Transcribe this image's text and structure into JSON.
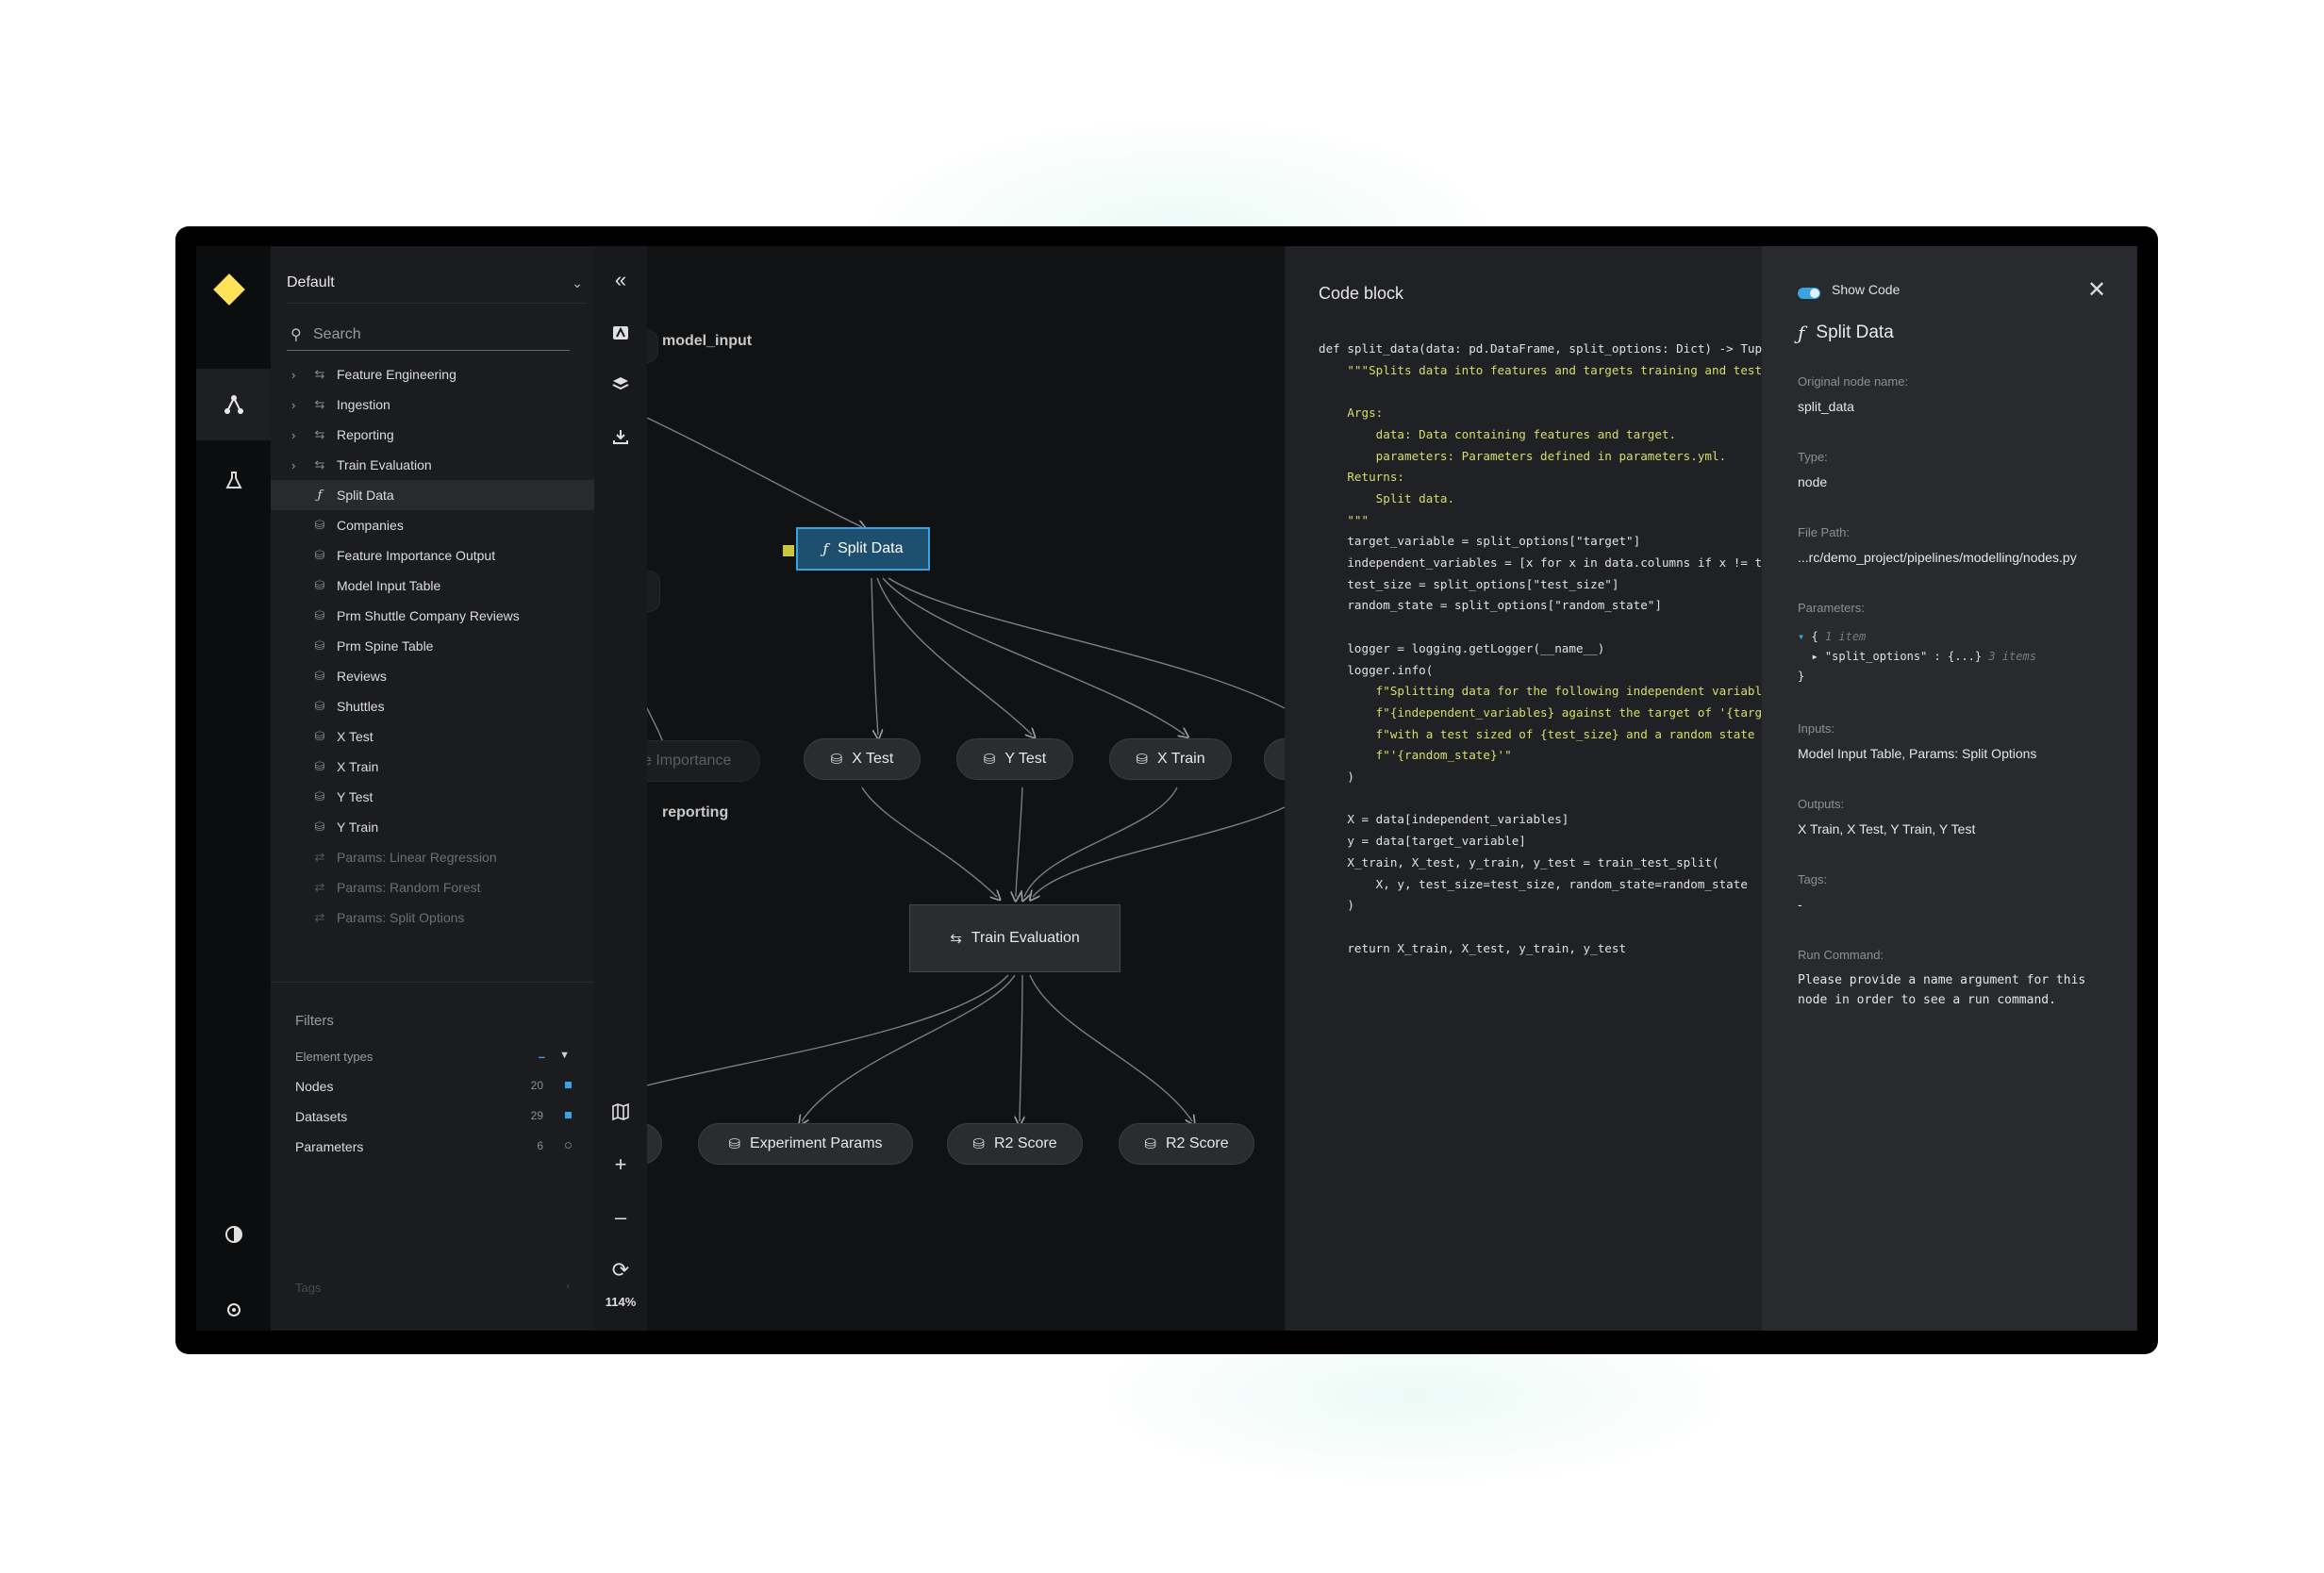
{
  "app": {
    "pipeline": "Default",
    "search_placeholder": "Search",
    "zoom": "114%"
  },
  "tree": [
    {
      "label": "Feature Engineering",
      "icon": "pipeline-icon",
      "expandable": true,
      "state": "normal"
    },
    {
      "label": "Ingestion",
      "icon": "pipeline-icon",
      "expandable": true,
      "state": "normal"
    },
    {
      "label": "Reporting",
      "icon": "pipeline-icon",
      "expandable": true,
      "state": "normal"
    },
    {
      "label": "Train Evaluation",
      "icon": "pipeline-icon",
      "expandable": true,
      "state": "normal"
    },
    {
      "label": "Split Data",
      "icon": "function-icon",
      "expandable": false,
      "state": "active"
    },
    {
      "label": "Companies",
      "icon": "dataset-icon",
      "expandable": false,
      "state": "normal"
    },
    {
      "label": "Feature Importance Output",
      "icon": "dataset-icon",
      "expandable": false,
      "state": "normal"
    },
    {
      "label": "Model Input Table",
      "icon": "dataset-icon",
      "expandable": false,
      "state": "normal"
    },
    {
      "label": "Prm Shuttle Company Reviews",
      "icon": "dataset-icon",
      "expandable": false,
      "state": "normal"
    },
    {
      "label": "Prm Spine Table",
      "icon": "dataset-icon",
      "expandable": false,
      "state": "normal"
    },
    {
      "label": "Reviews",
      "icon": "dataset-icon",
      "expandable": false,
      "state": "normal"
    },
    {
      "label": "Shuttles",
      "icon": "dataset-icon",
      "expandable": false,
      "state": "normal"
    },
    {
      "label": "X Test",
      "icon": "dataset-icon",
      "expandable": false,
      "state": "normal"
    },
    {
      "label": "X Train",
      "icon": "dataset-icon",
      "expandable": false,
      "state": "normal"
    },
    {
      "label": "Y Test",
      "icon": "dataset-icon",
      "expandable": false,
      "state": "normal"
    },
    {
      "label": "Y Train",
      "icon": "dataset-icon",
      "expandable": false,
      "state": "normal"
    },
    {
      "label": "Params: Linear Regression",
      "icon": "parameters-icon",
      "expandable": false,
      "state": "faded"
    },
    {
      "label": "Params: Random Forest",
      "icon": "parameters-icon",
      "expandable": false,
      "state": "faded"
    },
    {
      "label": "Params: Split Options",
      "icon": "parameters-icon",
      "expandable": false,
      "state": "faded"
    }
  ],
  "filters": {
    "title": "Filters",
    "element_types_label": "Element types",
    "rows": [
      {
        "label": "Nodes",
        "count": "20",
        "color": "#3aa4e3"
      },
      {
        "label": "Datasets",
        "count": "29",
        "color": "#3aa4e3"
      },
      {
        "label": "Parameters",
        "count": "6",
        "color": "#6e6f74"
      }
    ],
    "tags_label": "Tags"
  },
  "graph": {
    "labels": {
      "model_input": "model_input",
      "reporting": "reporting"
    },
    "nodes": {
      "split_data": "Split Data",
      "feature_importance": "re Importance",
      "x_test": "X Test",
      "y_test": "Y Test",
      "x_train": "X Train",
      "train_evaluation": "Train Evaluation",
      "experiment_params": "Experiment Params",
      "r2_score_1": "R2 Score",
      "r2_score_2": "R2 Score"
    }
  },
  "code": {
    "title": "Code block",
    "lines": [
      {
        "text": "def split_data(data: pd.DataFrame, split_options: Dict) -> Tuple:",
        "s": false
      },
      {
        "text": "    \"\"\"Splits data into features and targets training and test sets.",
        "s": true
      },
      {
        "text": "",
        "s": false
      },
      {
        "text": "    Args:",
        "s": true
      },
      {
        "text": "        data: Data containing features and target.",
        "s": true
      },
      {
        "text": "        parameters: Parameters defined in parameters.yml.",
        "s": true
      },
      {
        "text": "    Returns:",
        "s": true
      },
      {
        "text": "        Split data.",
        "s": true
      },
      {
        "text": "    \"\"\"",
        "s": true
      },
      {
        "text": "    target_variable = split_options[\"target\"]",
        "s": false
      },
      {
        "text": "    independent_variables = [x for x in data.columns if x != target_variable]",
        "s": false
      },
      {
        "text": "    test_size = split_options[\"test_size\"]",
        "s": false
      },
      {
        "text": "    random_state = split_options[\"random_state\"]",
        "s": false
      },
      {
        "text": "",
        "s": false
      },
      {
        "text": "    logger = logging.getLogger(__name__)",
        "s": false
      },
      {
        "text": "    logger.info(",
        "s": false
      },
      {
        "text": "        f\"Splitting data for the following independent variables\"",
        "s": true
      },
      {
        "text": "        f\"{independent_variables} against the target of '{target_variable}' \"",
        "s": true
      },
      {
        "text": "        f\"with a test sized of {test_size} and a random state of \"",
        "s": true
      },
      {
        "text": "        f\"'{random_state}'\"",
        "s": true
      },
      {
        "text": "    )",
        "s": false
      },
      {
        "text": "",
        "s": false
      },
      {
        "text": "    X = data[independent_variables]",
        "s": false
      },
      {
        "text": "    y = data[target_variable]",
        "s": false
      },
      {
        "text": "    X_train, X_test, y_train, y_test = train_test_split(",
        "s": false
      },
      {
        "text": "        X, y, test_size=test_size, random_state=random_state",
        "s": false
      },
      {
        "text": "    )",
        "s": false
      },
      {
        "text": "",
        "s": false
      },
      {
        "text": "    return X_train, X_test, y_train, y_test",
        "s": false
      }
    ]
  },
  "meta": {
    "show_code_label": "Show Code",
    "node_title": "Split Data",
    "original_name_label": "Original node name:",
    "original_name": "split_data",
    "type_label": "Type:",
    "type": "node",
    "file_path_label": "File Path:",
    "file_path": "...rc/demo_project/pipelines/modelling/nodes.py",
    "parameters_label": "Parameters:",
    "params_line1_brace": "{",
    "params_line1_note": "1 item",
    "params_line2_key": "\"split_options\"",
    "params_line2_val": ": {...}",
    "params_line2_note": "3 items",
    "params_line3": "}",
    "inputs_label": "Inputs:",
    "inputs": "Model Input Table,   Params: Split Options",
    "outputs_label": "Outputs:",
    "outputs": "X Train,   X Test,   Y Train,   Y Test",
    "tags_label": "Tags:",
    "tags": "-",
    "run_command_label": "Run Command:",
    "run_command_1": "Please provide a name argument for this",
    "run_command_2": "node in order to see a run command."
  }
}
